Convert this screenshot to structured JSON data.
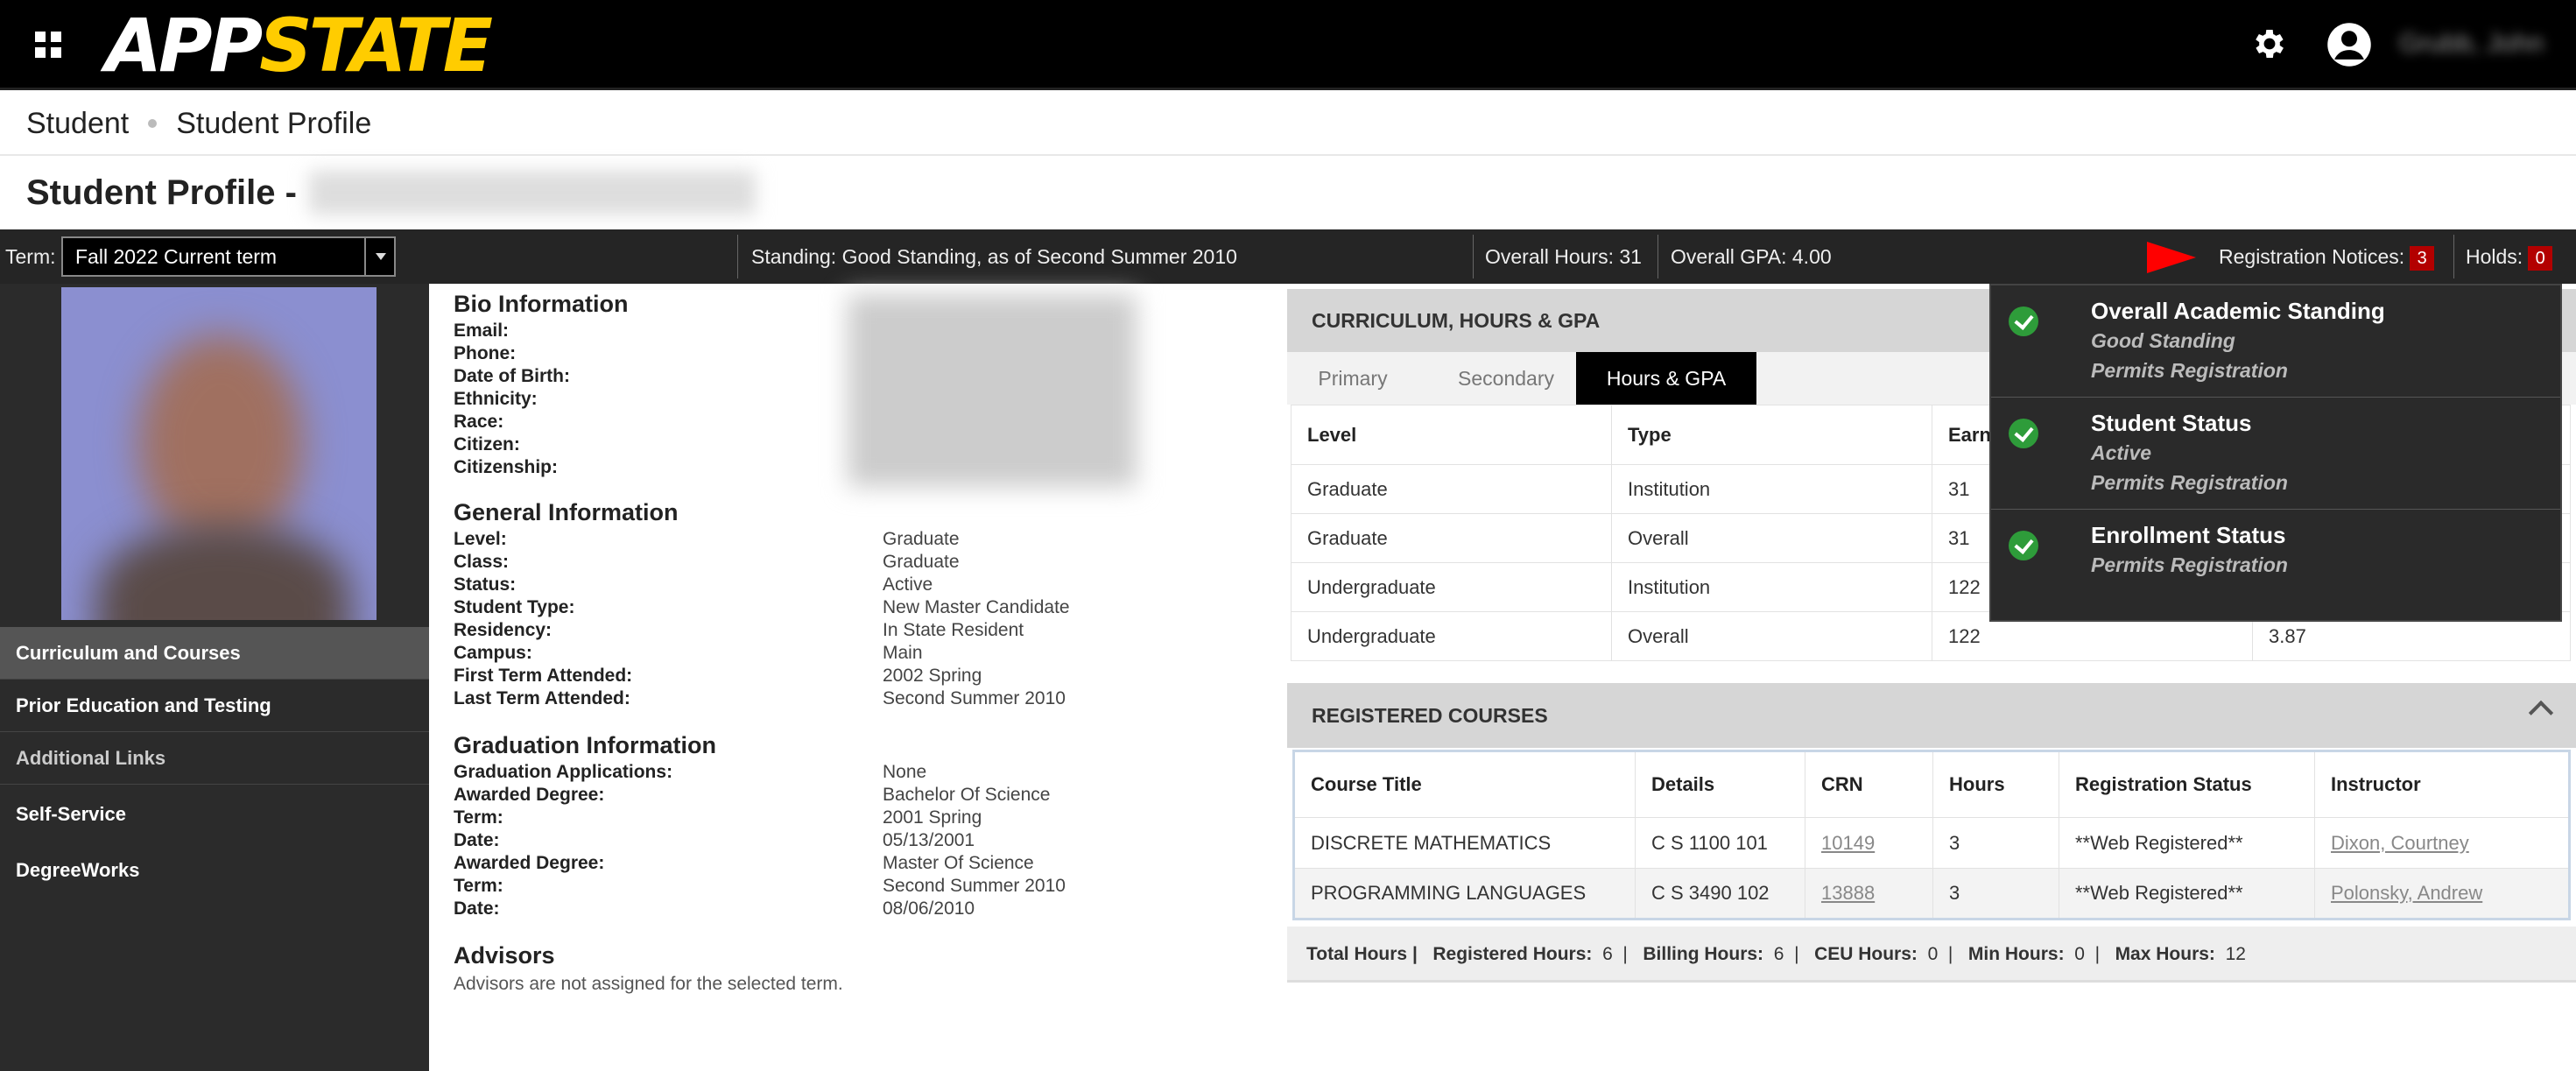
{
  "topbar": {
    "logo_app": "APP",
    "logo_state": "STATE",
    "user_name": "Grubb, John"
  },
  "breadcrumb": {
    "items": [
      "Student",
      "Student Profile"
    ]
  },
  "page": {
    "title": "Student Profile -"
  },
  "strip": {
    "term_label": "Term:",
    "term_value": "Fall 2022 Current term",
    "standing": "Standing: Good Standing, as of Second Summer 2010",
    "overall_hours": "Overall Hours: 31",
    "overall_gpa": "Overall GPA: 4.00",
    "registration_notices_label": "Registration Notices:",
    "registration_notices_count": "3",
    "holds_label": "Holds:",
    "holds_count": "0"
  },
  "sidebar": {
    "items": [
      "Curriculum and Courses",
      "Prior Education and Testing",
      "Additional Links",
      "Self-Service",
      "DegreeWorks"
    ]
  },
  "bio": {
    "title": "Bio Information",
    "labels": [
      "Email:",
      "Phone:",
      "Date of Birth:",
      "Ethnicity:",
      "Race:",
      "Citizen:",
      "Citizenship:"
    ]
  },
  "general": {
    "title": "General Information",
    "rows": [
      {
        "label": "Level:",
        "value": "Graduate"
      },
      {
        "label": "Class:",
        "value": "Graduate"
      },
      {
        "label": "Status:",
        "value": "Active"
      },
      {
        "label": "Student Type:",
        "value": "New Master Candidate"
      },
      {
        "label": "Residency:",
        "value": "In State Resident"
      },
      {
        "label": "Campus:",
        "value": "Main"
      },
      {
        "label": "First Term Attended:",
        "value": "2002 Spring"
      },
      {
        "label": "Last Term Attended:",
        "value": "Second Summer 2010"
      }
    ]
  },
  "graduation": {
    "title": "Graduation Information",
    "rows": [
      {
        "label": "Graduation Applications:",
        "value": "None"
      },
      {
        "label": "Awarded Degree:",
        "value": "Bachelor Of Science"
      },
      {
        "label": "Term:",
        "value": "2001 Spring"
      },
      {
        "label": "Date:",
        "value": "05/13/2001"
      },
      {
        "label": "Awarded Degree:",
        "value": "Master Of Science"
      },
      {
        "label": "Term:",
        "value": "Second Summer 2010"
      },
      {
        "label": "Date:",
        "value": "08/06/2010"
      }
    ]
  },
  "advisors": {
    "title": "Advisors",
    "note": "Advisors are not assigned for the selected term."
  },
  "curriculum": {
    "title": "CURRICULUM, HOURS & GPA",
    "tabs": [
      "Primary",
      "Secondary",
      "Hours & GPA"
    ],
    "headers": [
      "Level",
      "Type",
      "Earn"
    ],
    "rows": [
      {
        "level": "Graduate",
        "type": "Institution",
        "earned": "31",
        "gpa": ""
      },
      {
        "level": "Graduate",
        "type": "Overall",
        "earned": "31",
        "gpa": ""
      },
      {
        "level": "Undergraduate",
        "type": "Institution",
        "earned": "122",
        "gpa": ""
      },
      {
        "level": "Undergraduate",
        "type": "Overall",
        "earned": "122",
        "gpa": "3.87"
      }
    ]
  },
  "notices": [
    {
      "title": "Overall Academic Standing",
      "lines": [
        "Good Standing",
        "Permits Registration"
      ]
    },
    {
      "title": "Student Status",
      "lines": [
        "Active",
        "Permits Registration"
      ]
    },
    {
      "title": "Enrollment Status",
      "lines": [
        "Permits Registration"
      ]
    }
  ],
  "registered": {
    "title": "REGISTERED COURSES",
    "headers": [
      "Course Title",
      "Details",
      "CRN",
      "Hours",
      "Registration Status",
      "Instructor"
    ],
    "rows": [
      {
        "title": "DISCRETE MATHEMATICS",
        "details": "C S 1100 101",
        "crn": "10149",
        "hours": "3",
        "status": "**Web Registered**",
        "instructor": "Dixon, Courtney"
      },
      {
        "title": "PROGRAMMING LANGUAGES",
        "details": "C S 3490 102",
        "crn": "13888",
        "hours": "3",
        "status": "**Web Registered**",
        "instructor": "Polonsky, Andrew"
      }
    ]
  },
  "totals": {
    "total_label": "Total Hours |",
    "registered_label": "Registered Hours:",
    "registered_value": "6",
    "billing_label": "Billing Hours:",
    "billing_value": "6",
    "ceu_label": "CEU Hours:",
    "ceu_value": "0",
    "min_label": "Min Hours:",
    "min_value": "0",
    "max_label": "Max Hours:",
    "max_value": "12"
  }
}
